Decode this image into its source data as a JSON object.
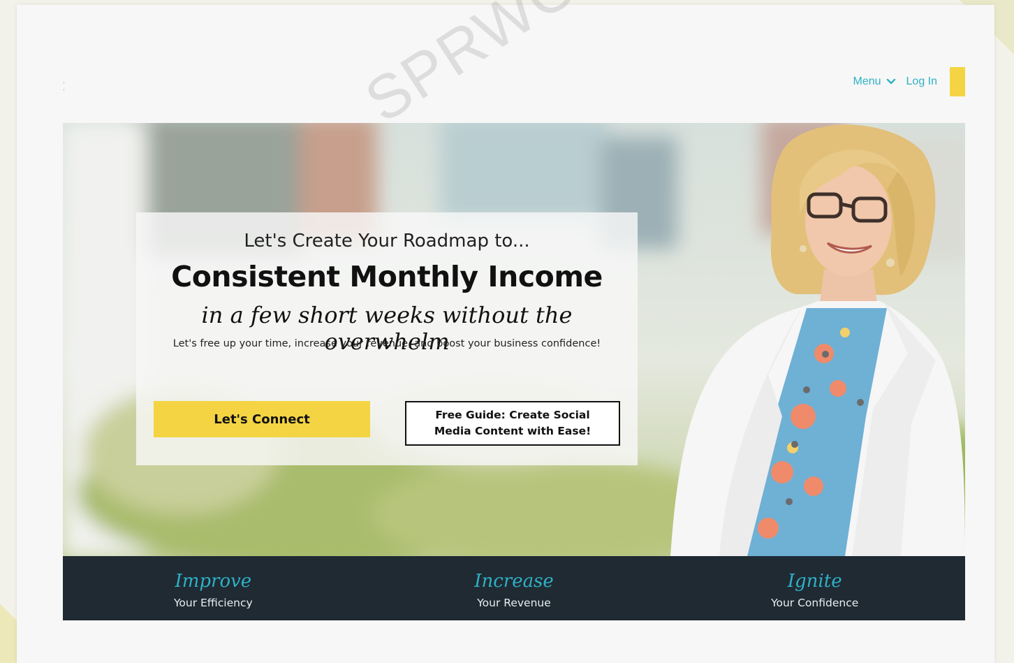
{
  "nav": {
    "menu_label": "Menu",
    "login_label": "Log In"
  },
  "hero": {
    "eyebrow": "Let's Create Your Roadmap to...",
    "headline": "Consistent Monthly Income",
    "script_line": "in a few short weeks without the overwhelm",
    "subtext": "Let's free up your time, increase your revenue, and boost your business confidence!",
    "primary_button": "Let's Connect",
    "secondary_button": "Free Guide: Create Social Media Content with Ease!"
  },
  "pillars": [
    {
      "script": "Improve",
      "label": "Your Efficiency"
    },
    {
      "script": "Increase",
      "label": "Your Revenue"
    },
    {
      "script": "Ignite",
      "label": "Your Confidence"
    }
  ],
  "watermark": "SPRWO",
  "colors": {
    "accent_teal": "#2fb0c5",
    "accent_yellow": "#f4d443",
    "dark_strip": "#1f2a33"
  }
}
